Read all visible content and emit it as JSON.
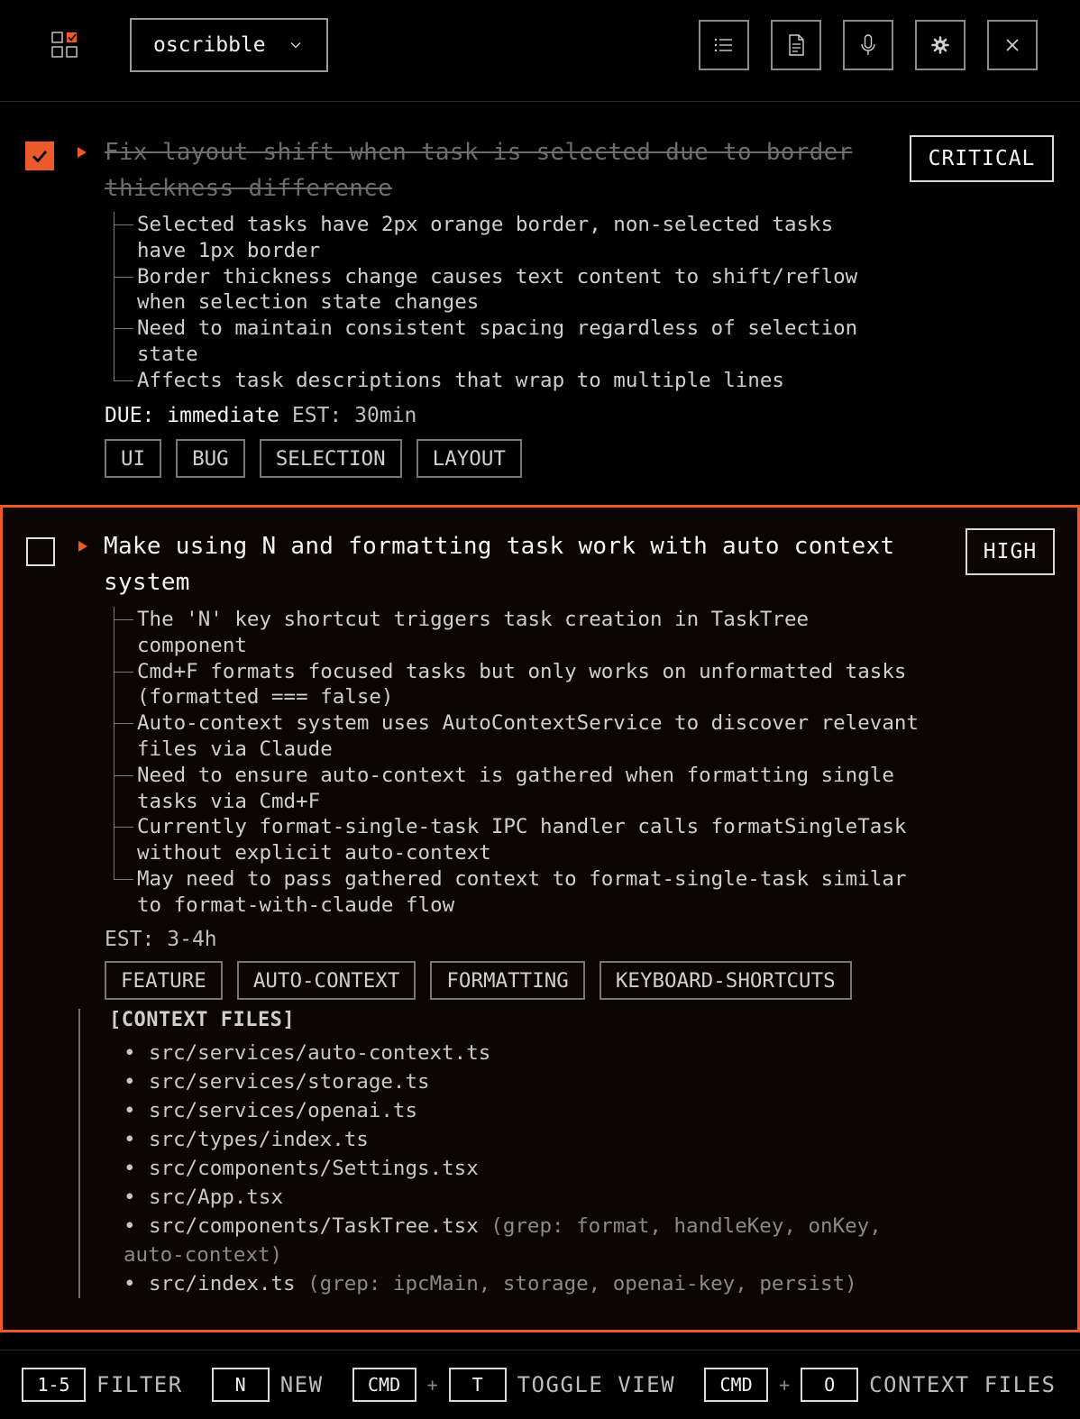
{
  "header": {
    "project": "oscribble",
    "buttons": [
      "list-icon",
      "document-icon",
      "mic-icon",
      "gear-icon",
      "close-icon"
    ]
  },
  "tasks": [
    {
      "completed": true,
      "title_line1": "Fix layout shift when task is selected due to border",
      "title_line2": "thickness difference",
      "priority": "CRITICAL",
      "notes": [
        [
          "Selected tasks have 2px orange border, non-selected tasks",
          "have 1px border"
        ],
        [
          "Border thickness change causes text content to shift/reflow",
          "when selection state changes"
        ],
        [
          "Need to maintain consistent spacing regardless of selection",
          "state"
        ],
        [
          "Affects task descriptions that wrap to multiple lines"
        ]
      ],
      "due_label": "DUE:",
      "due_value": "immediate",
      "est_label": "EST:",
      "est_value": "30min",
      "tags": [
        "UI",
        "BUG",
        "SELECTION",
        "LAYOUT"
      ]
    },
    {
      "completed": false,
      "title_line1": "Make using N and formatting task work with auto context",
      "title_line2": "system",
      "priority": "HIGH",
      "notes": [
        [
          "The 'N' key shortcut triggers task creation in TaskTree",
          "component"
        ],
        [
          "Cmd+F formats focused tasks but only works on unformatted tasks",
          "(formatted === false)"
        ],
        [
          "Auto-context system uses AutoContextService to discover relevant",
          "files via Claude"
        ],
        [
          "Need to ensure auto-context is gathered when formatting single",
          "tasks via Cmd+F"
        ],
        [
          "Currently format-single-task IPC handler calls formatSingleTask",
          "without explicit auto-context"
        ],
        [
          "May need to pass gathered context to format-single-task similar",
          "to format-with-claude flow"
        ]
      ],
      "est_label": "EST:",
      "est_value": "3-4h",
      "tags": [
        "FEATURE",
        "AUTO-CONTEXT",
        "FORMATTING",
        "KEYBOARD-SHORTCUTS"
      ],
      "context_title": "[CONTEXT FILES]",
      "context_files": [
        {
          "path": "src/services/auto-context.ts",
          "grep": ""
        },
        {
          "path": "src/services/storage.ts",
          "grep": ""
        },
        {
          "path": "src/services/openai.ts",
          "grep": ""
        },
        {
          "path": "src/types/index.ts",
          "grep": ""
        },
        {
          "path": "src/components/Settings.tsx",
          "grep": ""
        },
        {
          "path": "src/App.tsx",
          "grep": ""
        },
        {
          "path": "src/components/TaskTree.tsx",
          "grep": "(grep: format, handleKey, onKey,",
          "grep2": "auto-context)"
        },
        {
          "path": "src/index.ts",
          "grep": "(grep: ipcMain, storage, openai-key, persist)"
        }
      ]
    }
  ],
  "footer": {
    "items": [
      {
        "keys": [
          "1-5"
        ],
        "label": "FILTER"
      },
      {
        "keys": [
          "N"
        ],
        "label": "NEW"
      },
      {
        "keys": [
          "CMD",
          "T"
        ],
        "label": "TOGGLE VIEW"
      },
      {
        "keys": [
          "CMD",
          "O"
        ],
        "label": "CONTEXT FILES"
      }
    ],
    "plus": "+"
  },
  "colors": {
    "accent": "#f0582a",
    "background": "#000000",
    "selected_background": "#0b0503"
  }
}
